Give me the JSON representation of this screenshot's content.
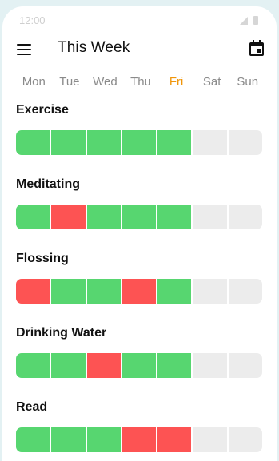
{
  "status": {
    "time": "12:00"
  },
  "header": {
    "title": "This Week"
  },
  "days": [
    {
      "label": "Mon",
      "current": false
    },
    {
      "label": "Tue",
      "current": false
    },
    {
      "label": "Wed",
      "current": false
    },
    {
      "label": "Thu",
      "current": false
    },
    {
      "label": "Fri",
      "current": true
    },
    {
      "label": "Sat",
      "current": false
    },
    {
      "label": "Sun",
      "current": false
    }
  ],
  "habits": [
    {
      "name": "Exercise",
      "week": [
        "done",
        "done",
        "done",
        "done",
        "done",
        "empty",
        "empty"
      ]
    },
    {
      "name": "Meditating",
      "week": [
        "done",
        "missed",
        "done",
        "done",
        "done",
        "empty",
        "empty"
      ]
    },
    {
      "name": "Flossing",
      "week": [
        "missed",
        "done",
        "done",
        "missed",
        "done",
        "empty",
        "empty"
      ]
    },
    {
      "name": "Drinking Water",
      "week": [
        "done",
        "done",
        "missed",
        "done",
        "done",
        "empty",
        "empty"
      ]
    },
    {
      "name": "Read",
      "week": [
        "done",
        "done",
        "done",
        "missed",
        "missed",
        "empty",
        "empty"
      ]
    }
  ],
  "colors": {
    "done": "#57d670",
    "missed": "#fd5353",
    "empty": "#ececec",
    "current_day": "#f0960b"
  }
}
